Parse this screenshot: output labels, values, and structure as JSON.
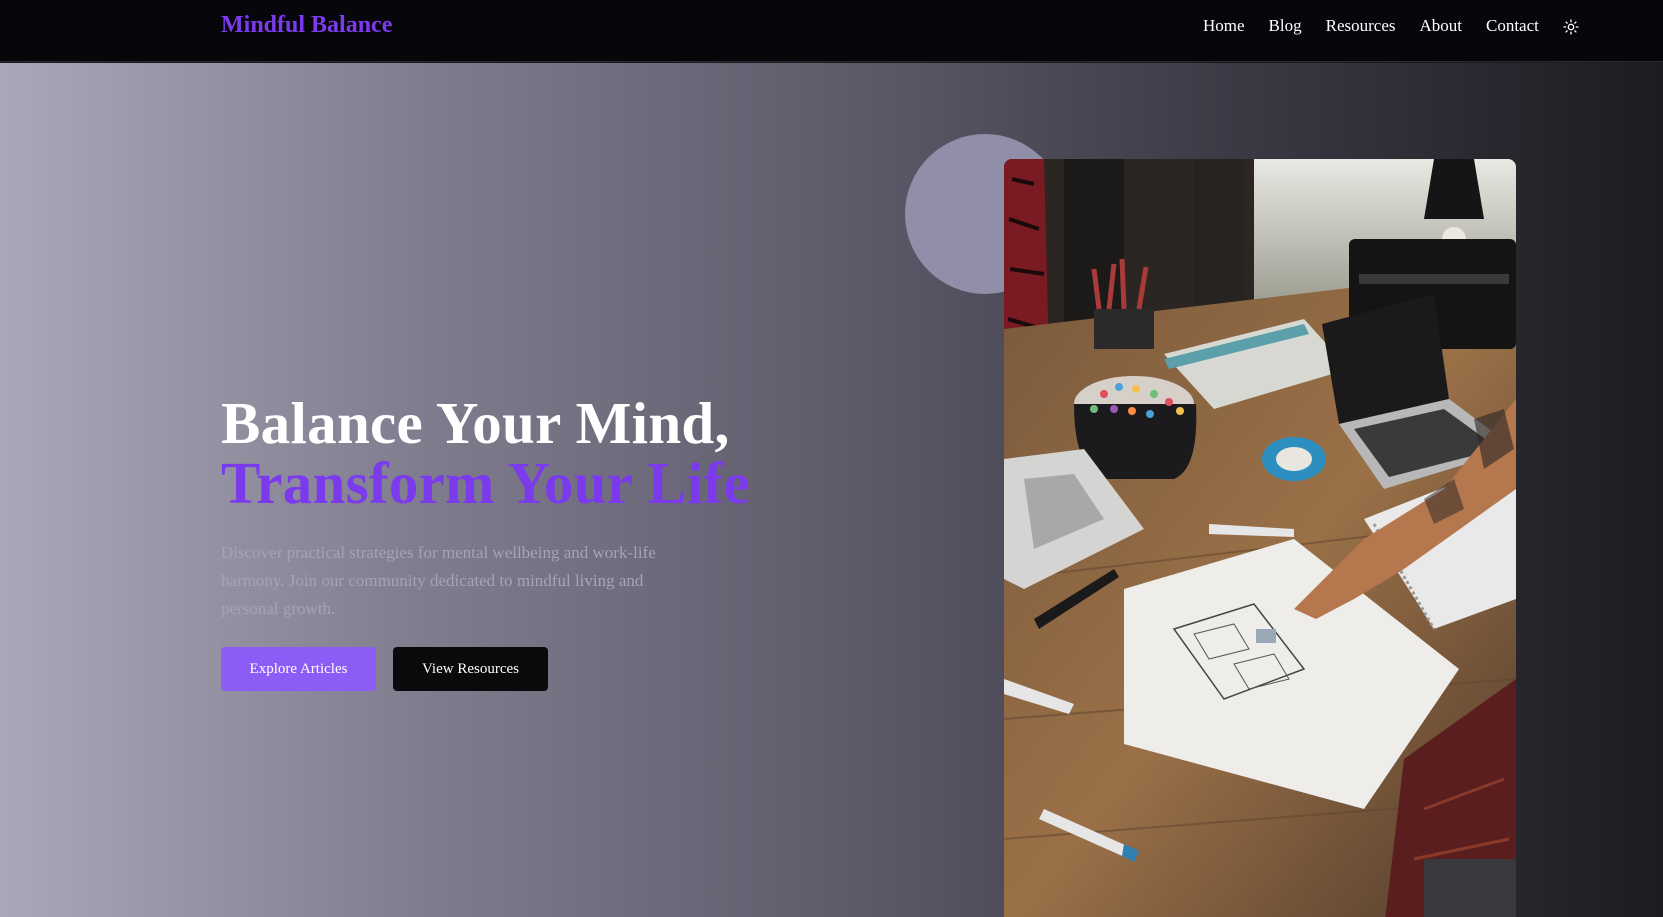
{
  "brand": {
    "name": "Mindful Balance",
    "color": "#7c3aed"
  },
  "nav": {
    "items": [
      {
        "label": "Home"
      },
      {
        "label": "Blog"
      },
      {
        "label": "Resources"
      },
      {
        "label": "About"
      },
      {
        "label": "Contact"
      }
    ],
    "theme_toggle_icon": "sun-icon"
  },
  "hero": {
    "title_line1": "Balance Your Mind,",
    "title_line2": "Transform Your Life",
    "description": "Discover practical strategies for mental wellbeing and work-life harmony. Join our community dedicated to mindful living and personal growth.",
    "primary_button": "Explore Articles",
    "secondary_button": "View Resources",
    "image_icon": "workspace-photo"
  },
  "colors": {
    "accent": "#7c3aed",
    "button_primary": "#8b5cf6",
    "button_secondary": "#0a0a0d",
    "header_bg": "#07070b"
  }
}
